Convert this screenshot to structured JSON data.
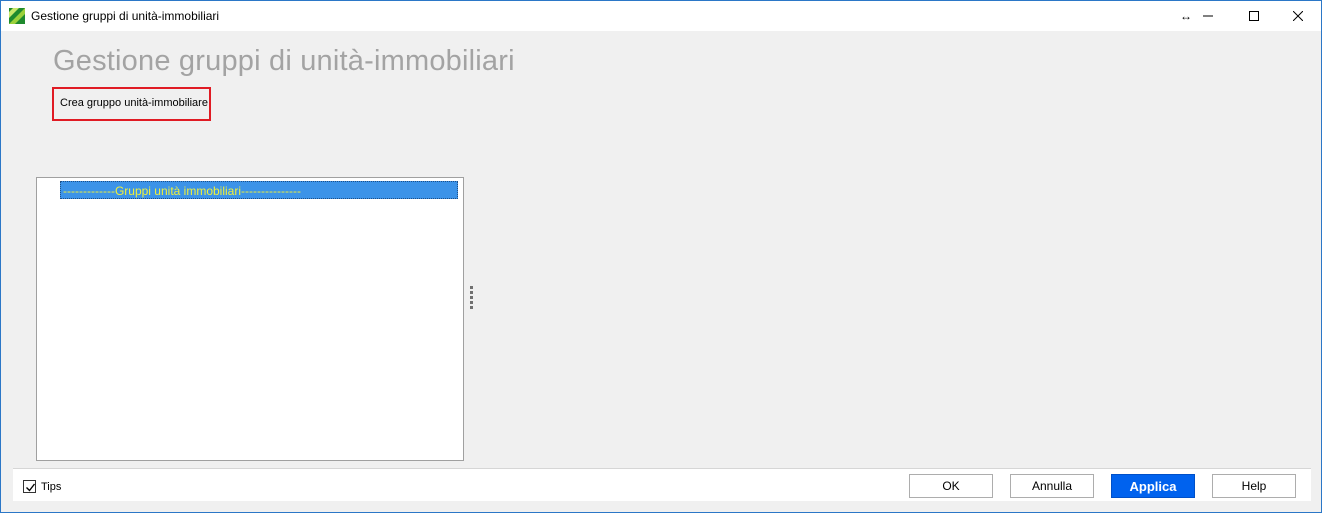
{
  "window": {
    "title": "Gestione gruppi di unità-immobiliari",
    "resize_glyph": "↔",
    "minimize_glyph": "—",
    "maximize_glyph": "☐",
    "close_glyph": "✕"
  },
  "page": {
    "heading": "Gestione gruppi di unità-immobiliari",
    "create_link": "Crea gruppo unità-immobiliare"
  },
  "tree": {
    "items": [
      {
        "label": "-------------Gruppi unità immobiliari---------------",
        "selected": true
      }
    ]
  },
  "footer": {
    "tips_label": "Tips",
    "tips_checked": true,
    "ok_label": "OK",
    "cancel_label": "Annulla",
    "apply_label": "Applica",
    "help_label": "Help"
  },
  "colors": {
    "selection_bg": "#3c93e8",
    "selection_text": "#f0f03a",
    "apply_bg": "#0062ee",
    "highlight_border": "#e01b24"
  }
}
